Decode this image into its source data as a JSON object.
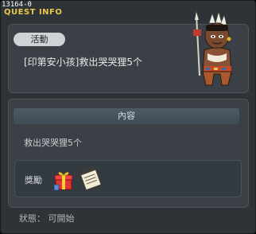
{
  "quest": {
    "id_text": "13164-0",
    "window_title": "QUEST INFO",
    "category_badge": "活動",
    "name": "[印第安小孩]救出哭哭狸5个"
  },
  "content": {
    "header": "內容",
    "description": "救出哭哭狸5个"
  },
  "reward": {
    "label": "獎勵",
    "items": [
      "gift-box-icon",
      "scroll-item-icon"
    ]
  },
  "status": {
    "text": "狀態： 可開始"
  },
  "colors": {
    "title": "#e8c84a",
    "background": "#2e3338",
    "panel": "#3a4045"
  }
}
